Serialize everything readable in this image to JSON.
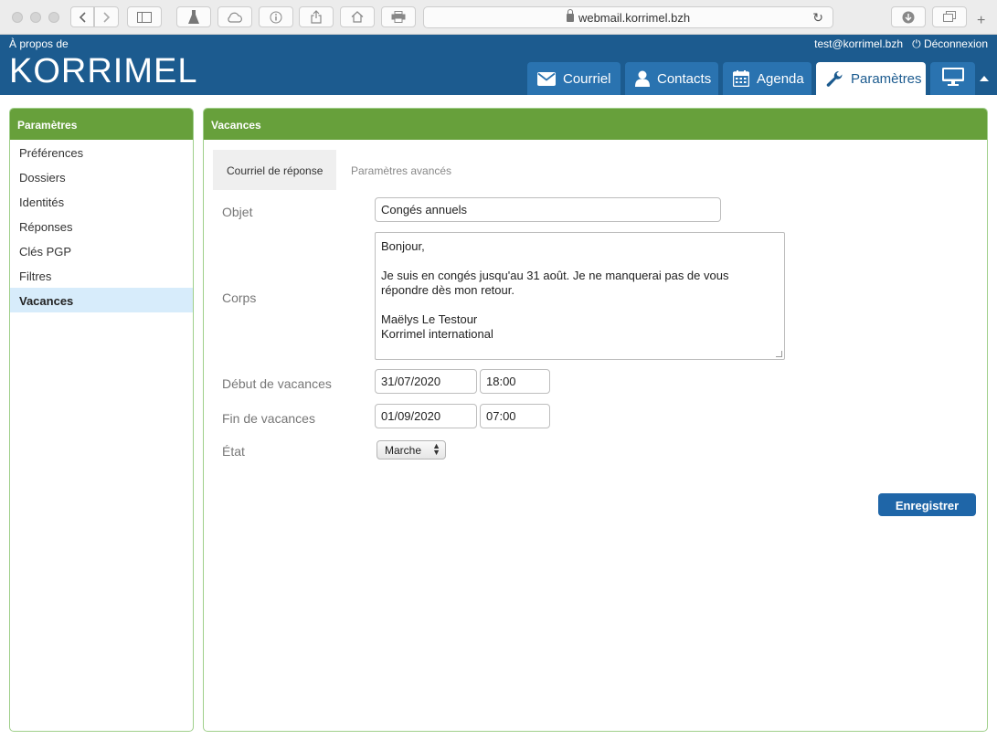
{
  "browser": {
    "url": "webmail.korrimel.bzh",
    "new_tab": "+"
  },
  "header": {
    "about": "À propos de",
    "logo": "KORRIMEL",
    "user_email": "test@korrimel.bzh",
    "logout": "Déconnexion",
    "tabs": [
      {
        "label": "Courriel",
        "icon": "envelope-icon"
      },
      {
        "label": "Contacts",
        "icon": "user-icon"
      },
      {
        "label": "Agenda",
        "icon": "calendar-icon"
      },
      {
        "label": "Paramètres",
        "icon": "wrench-icon"
      }
    ],
    "display_icon": "monitor-icon"
  },
  "sidebar": {
    "title": "Paramètres",
    "items": [
      {
        "label": "Préférences"
      },
      {
        "label": "Dossiers"
      },
      {
        "label": "Identités"
      },
      {
        "label": "Réponses"
      },
      {
        "label": "Clés PGP"
      },
      {
        "label": "Filtres"
      },
      {
        "label": "Vacances",
        "active": true
      }
    ]
  },
  "main": {
    "title": "Vacances",
    "subtabs": [
      {
        "label": "Courriel de réponse",
        "active": true
      },
      {
        "label": "Paramètres avancés",
        "active": false
      }
    ],
    "form": {
      "subject_label": "Objet",
      "subject_value": "Congés annuels",
      "body_label": "Corps",
      "body_value": "Bonjour,\n\nJe suis en congés jusqu'au 31 août. Je ne manquerai pas de vous répondre dès mon retour.\n\nMaëlys Le Testour\nKorrimel international",
      "start_label": "Début de vacances",
      "start_date": "31/07/2020",
      "start_time": "18:00",
      "end_label": "Fin de vacances",
      "end_date": "01/09/2020",
      "end_time": "07:00",
      "state_label": "État",
      "state_value": "Marche",
      "save_label": "Enregistrer"
    }
  },
  "colors": {
    "header_bg": "#1c5b8f",
    "tab_bg": "#2a73b0",
    "panel_head": "#67a03b",
    "active_nav": "#d7ecfb",
    "save_button": "#1f66a8"
  }
}
